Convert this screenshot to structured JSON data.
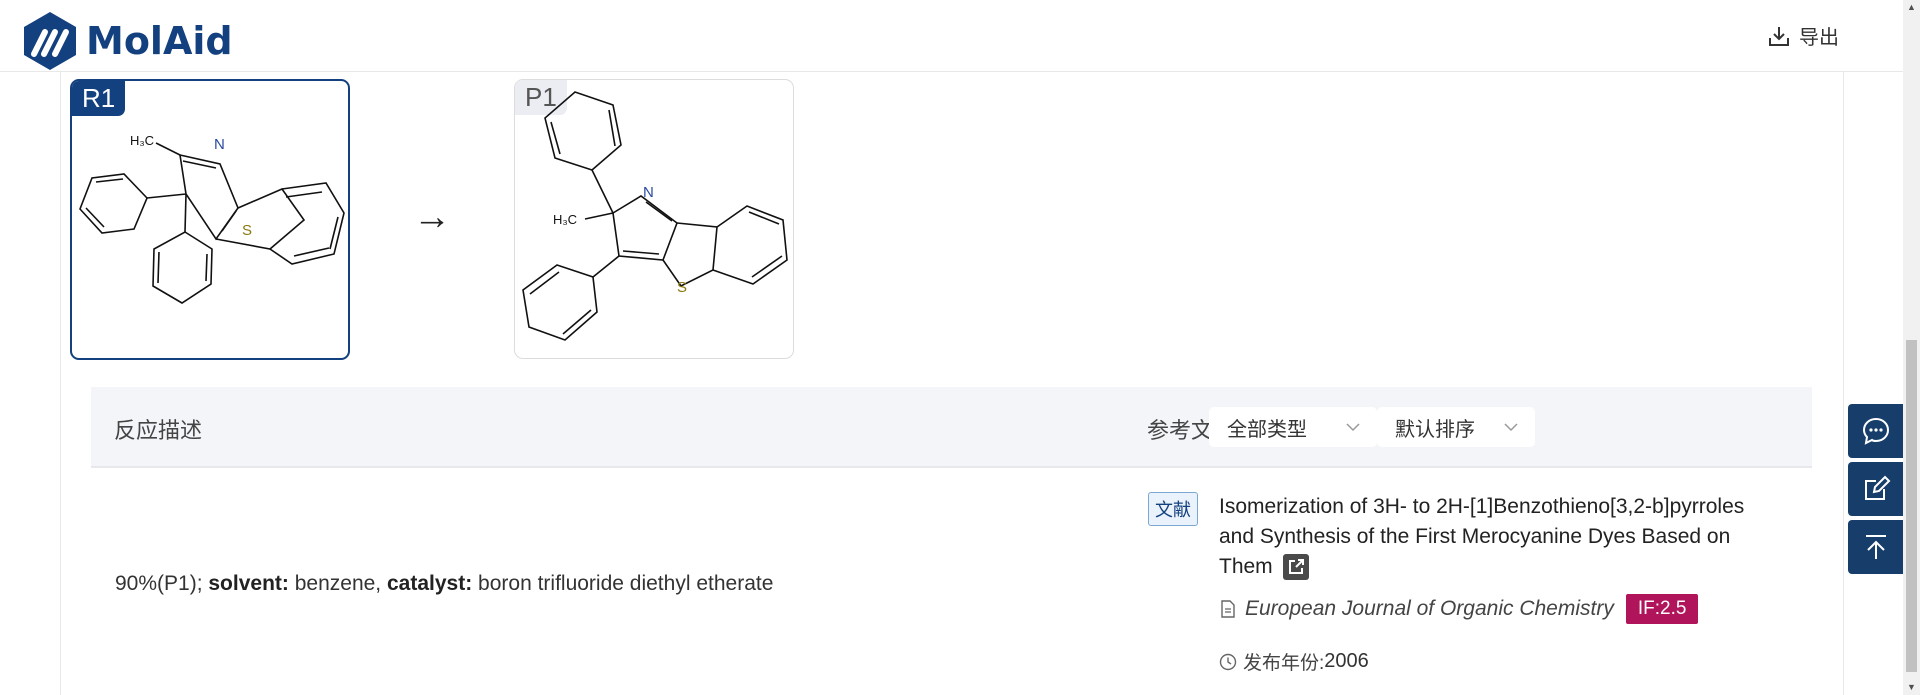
{
  "header": {
    "logo_text": "MolAid",
    "export_label": "导出"
  },
  "reaction": {
    "reactant_tag": "R1",
    "product_tag": "P1",
    "arrow": "→",
    "reactant_labels": {
      "h3c": "H₃C",
      "n": "N",
      "s": "S"
    },
    "product_labels": {
      "h3c": "H₃C",
      "n": "N",
      "s": "S"
    }
  },
  "bar": {
    "title": "反应描述",
    "refs_label": "参考文献",
    "type_filter": "全部类型",
    "sort_filter": "默认排序"
  },
  "description": {
    "yield": "90%(P1); ",
    "solvent_label": "solvent:",
    "solvent_value": " benzene, ",
    "catalyst_label": "catalyst:",
    "catalyst_value": " boron trifluoride diethyl etherate"
  },
  "reference": {
    "badge": "文献",
    "title": "Isomerization of 3H- to 2H-[1]Benzothieno[3,2-b]pyrroles and Synthesis of the First Merocyanine Dyes Based on Them",
    "journal": "European Journal of Organic Chemistry",
    "impact": "IF:2.5",
    "year_label": "发布年份:",
    "year": "2006"
  },
  "colors": {
    "brand": "#13407e",
    "if_badge": "#b0145a",
    "float_button": "#173e6a"
  },
  "icons": [
    "logo-icon",
    "download-icon",
    "chevron-down-icon",
    "external-link-icon",
    "document-icon",
    "clock-icon",
    "chat-icon",
    "edit-icon",
    "back-to-top-icon"
  ]
}
